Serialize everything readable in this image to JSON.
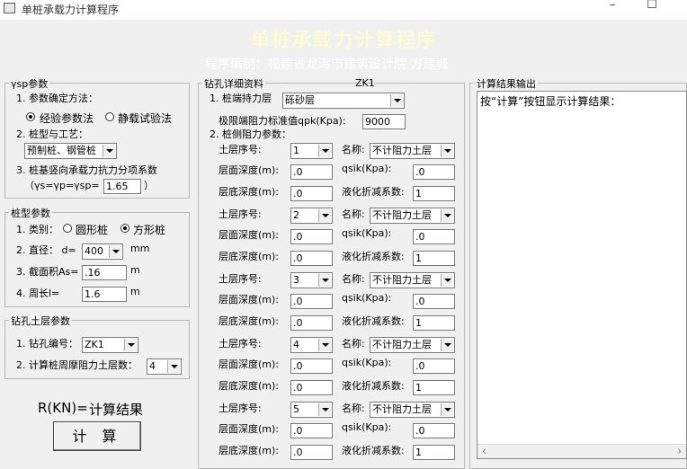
{
  "window": {
    "title": "单桩承载力计算程序",
    "minimize": "–",
    "maximize": "☐"
  },
  "banner": {
    "title": "单桩承载力计算程序",
    "subtitle": "程序编制：福建省龙海市建筑设计院    方建城"
  },
  "gamma": {
    "legend": "γsp参数",
    "method_label": "1. 参数确定方法：",
    "method_empirical": "经验参数法",
    "method_static": "静载试验法",
    "pile_type_label": "2. 桩型与工艺：",
    "pile_type_value": "预制桩、钢管桩",
    "coef_label": "3. 桩基竖向承载力抗力分项系数",
    "coef_formula": "（γs=γp=γsp=",
    "coef_value": "1.65",
    "coef_close": "）"
  },
  "pile": {
    "legend": "桩型参数",
    "type_label": "1. 类别：",
    "type_round": "圆形桩",
    "type_square": "方形桩",
    "diameter_label": "2. 直径：  d=",
    "diameter_value": "400",
    "diameter_unit": "mm",
    "area_label": "3. 截面积As=",
    "area_value": ".16",
    "area_unit": "m",
    "perimeter_label": "4. 周长l=",
    "perimeter_value": "1.6",
    "perimeter_unit": "m"
  },
  "borehole": {
    "legend": "钻孔土层参数",
    "no_label": "1. 钻孔编号：",
    "no_value": "ZK1",
    "layers_label": "2. 计算桩周摩阻力土层数：",
    "layers_value": "4"
  },
  "result": {
    "label": "R(KN)=",
    "value": "计算结果",
    "calc_button": "计 算"
  },
  "detail": {
    "legend": "钻孔详细资料",
    "borehole_id": "ZK1",
    "end_layer_label": "1. 桩端持力层",
    "end_layer_value": "砾砂层",
    "qpk_label": "极限端阻力标准值qpk(Kpa):",
    "qpk_value": "9000",
    "side_label": "2. 桩侧阻力参数：",
    "layer_no_label": "土层序号:",
    "name_label": "名称:",
    "top_label": "层面深度(m):",
    "bottom_label": "层底深度(m):",
    "qsik_label": "qsik(Kpa):",
    "reduction_label": "液化折减系数:",
    "layers": [
      {
        "no": "1",
        "name": "不计阻力土层",
        "top": ".0",
        "qsik": ".0",
        "bottom": ".0",
        "reduction": "1"
      },
      {
        "no": "2",
        "name": "不计阻力土层",
        "top": ".0",
        "qsik": ".0",
        "bottom": ".0",
        "reduction": "1"
      },
      {
        "no": "3",
        "name": "不计阻力土层",
        "top": ".0",
        "qsik": ".0",
        "bottom": ".0",
        "reduction": "1"
      },
      {
        "no": "4",
        "name": "不计阻力土层",
        "top": ".0",
        "qsik": ".0",
        "bottom": ".0",
        "reduction": "1"
      },
      {
        "no": "5",
        "name": "不计阻力土层",
        "top": ".0",
        "qsik": ".0",
        "bottom": ".0",
        "reduction": "1"
      }
    ]
  },
  "output": {
    "legend": "计算结果输出",
    "text": "按“计算”按钮显示计算结果：",
    "scroll_left": "‹",
    "scroll_right": "›"
  },
  "colors": {
    "banner_bg": "#f0f0f0",
    "banner_title": "#ffffcc",
    "banner_sub": "#ffffff"
  }
}
